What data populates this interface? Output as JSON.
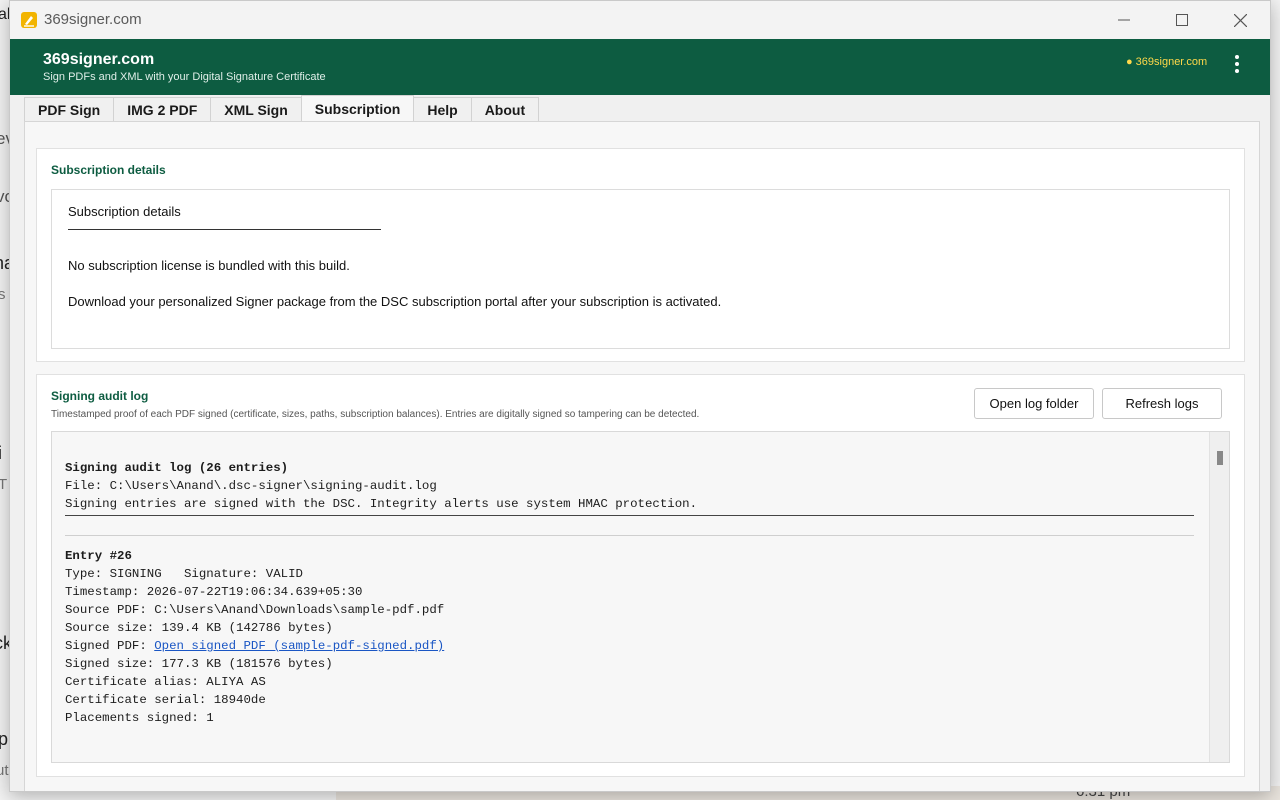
{
  "background": {
    "fragments": [
      "ak",
      "ev",
      "vo",
      "na",
      "s",
      "i",
      "T",
      "ck",
      "p",
      "ut"
    ],
    "time": "6:31 pm"
  },
  "window": {
    "title": "369signer.com",
    "icons": {
      "app": "pen-icon",
      "minimize": "minimize-icon",
      "maximize": "maximize-icon",
      "close": "close-icon"
    }
  },
  "header": {
    "title": "369signer.com",
    "subtitle": "Sign PDFs and XML with your Digital Signature Certificate",
    "link": "369signer.com",
    "colors": {
      "brand": "#0d5c41",
      "link": "#ffd84a"
    }
  },
  "tabs": [
    {
      "label": "PDF Sign",
      "active": false
    },
    {
      "label": "IMG 2 PDF",
      "active": false
    },
    {
      "label": "XML Sign",
      "active": false
    },
    {
      "label": "Subscription",
      "active": true
    },
    {
      "label": "Help",
      "active": false
    },
    {
      "label": "About",
      "active": false
    }
  ],
  "subscription": {
    "heading": "Subscription details",
    "inner_title": "Subscription details",
    "line1": "No subscription license is bundled with this build.",
    "line2": "Download your personalized Signer package from the DSC subscription portal after your subscription is activated."
  },
  "audit": {
    "heading": "Signing audit log",
    "description": "Timestamped proof of each PDF signed (certificate, sizes, paths, subscription balances). Entries are digitally signed so tampering can be detected.",
    "open_button": "Open log folder",
    "refresh_button": "Refresh logs",
    "log": {
      "title": "Signing audit log (26 entries)",
      "file": "File: C:\\Users\\Anand\\.dsc-signer\\signing-audit.log",
      "note": "Signing entries are signed with the DSC. Integrity alerts use system HMAC protection.",
      "entry": {
        "header": "Entry #26",
        "type": "Type: SIGNING   Signature: VALID",
        "timestamp": "Timestamp: 2026-07-22T19:06:34.639+05:30",
        "source_pdf": "Source PDF: C:\\Users\\Anand\\Downloads\\sample-pdf.pdf",
        "source_size": "Source size: 139.4 KB (142786 bytes)",
        "signed_pdf_label": "Signed PDF: ",
        "signed_pdf_link": "Open signed PDF (sample-pdf-signed.pdf)",
        "signed_size": "Signed size: 177.3 KB (181576 bytes)",
        "cert_alias": "Certificate alias: ALIYA AS",
        "cert_serial": "Certificate serial: 18940de",
        "placements": "Placements signed: 1"
      }
    }
  }
}
